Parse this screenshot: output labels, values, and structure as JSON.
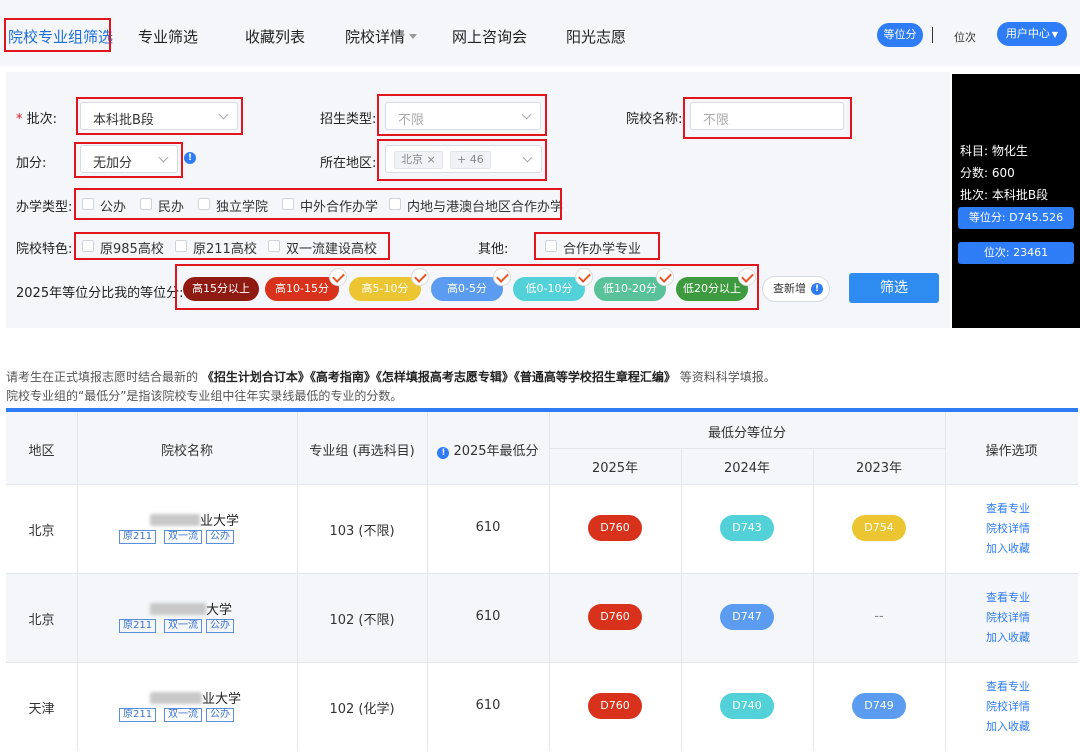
{
  "nav": {
    "items": [
      "院校专业组筛选",
      "专业筛选",
      "收藏列表",
      "院校详情",
      "网上咨询会",
      "阳光志愿"
    ],
    "rank_score_toggle": "等位分",
    "rank_toggle": "位次",
    "user_center": "用户中心"
  },
  "filters": {
    "batch_label": "批次:",
    "batch_required_mark": "*",
    "batch_value": "本科批B段",
    "enroll_type_label": "招生类型:",
    "enroll_type_placeholder": "不限",
    "school_name_label": "院校名称:",
    "school_name_placeholder": "不限",
    "bonus_label": "加分:",
    "bonus_value": "无加分",
    "region_label": "所在地区:",
    "region_tag": "北京",
    "region_more": "+ 46",
    "school_type_label": "办学类型:",
    "school_types": [
      "公办",
      "民办",
      "独立学院",
      "中外合作办学",
      "内地与港澳台地区合作办学"
    ],
    "feature_label": "院校特色:",
    "features": [
      "原985高校",
      "原211高校",
      "双一流建设高校"
    ],
    "other_label": "其他:",
    "other_option": "合作办学专业",
    "rank_compare_label": "2025年等位分比我的等位分:",
    "rank_ranges": [
      {
        "label": "高15分以上",
        "color": "#8e1a12",
        "checked": false
      },
      {
        "label": "高10-15分",
        "color": "#d8321c",
        "checked": true
      },
      {
        "label": "高5-10分",
        "color": "#ecc632",
        "checked": true
      },
      {
        "label": "高0-5分",
        "color": "#5b9cf0",
        "checked": true
      },
      {
        "label": "低0-10分",
        "color": "#52d1d8",
        "checked": true
      },
      {
        "label": "低10-20分",
        "color": "#5ac29a",
        "checked": true
      },
      {
        "label": "低20分以上",
        "color": "#3e9a3e",
        "checked": true
      }
    ],
    "check_new_label": "查新增",
    "filter_button": "筛选"
  },
  "card": {
    "subjects": "科目: 物化生",
    "score": "分数: 600",
    "batch": "批次: 本科批B段",
    "equiv_score": "等位分: D745.526",
    "rank": "位次: 23461"
  },
  "notes": {
    "line1_prefix": "请考生在正式填报志愿时结合最新的",
    "line1_books": "《招生计划合订本》《高考指南》《怎样填报高考志愿专辑》《普通高等学校招生章程汇编》",
    "line1_suffix": "等资料科学填报。",
    "line2": "院校专业组的“最低分”是指该院校专业组中往年实录线最低的专业的分数。"
  },
  "table": {
    "headers": {
      "region": "地区",
      "school": "院校名称",
      "group": "专业组 (再选科目)",
      "min_score": "2025年最低分",
      "equiv_group": "最低分等位分",
      "y2025": "2025年",
      "y2024": "2024年",
      "y2023": "2023年",
      "ops": "操作选项"
    },
    "rows": [
      {
        "region": "北京",
        "school_suffix": "业大学",
        "tags": [
          "原211",
          "双一流",
          "公办"
        ],
        "group": "103 (不限)",
        "min_score": "610",
        "ranks": [
          {
            "text": "D760",
            "color": "#d8321c"
          },
          {
            "text": "D743",
            "color": "#52d1d8"
          },
          {
            "text": "D754",
            "color": "#ecc632"
          }
        ],
        "ops": [
          "查看专业",
          "院校详情",
          "加入收藏"
        ]
      },
      {
        "region": "北京",
        "school_suffix": "大学",
        "tags": [
          "原211",
          "双一流",
          "公办"
        ],
        "group": "102 (不限)",
        "min_score": "610",
        "ranks": [
          {
            "text": "D760",
            "color": "#d8321c"
          },
          {
            "text": "D747",
            "color": "#5b9cf0"
          },
          {
            "text": "--",
            "color": ""
          }
        ],
        "ops": [
          "查看专业",
          "院校详情",
          "加入收藏"
        ]
      },
      {
        "region": "天津",
        "school_suffix": "业大学",
        "tags": [
          "原211",
          "双一流",
          "公办"
        ],
        "group": "102 (化学)",
        "min_score": "610",
        "ranks": [
          {
            "text": "D760",
            "color": "#d8321c"
          },
          {
            "text": "D740",
            "color": "#52d1d8"
          },
          {
            "text": "D749",
            "color": "#5b9cf0"
          }
        ],
        "ops": [
          "查看专业",
          "院校详情",
          "加入收藏"
        ]
      }
    ]
  }
}
